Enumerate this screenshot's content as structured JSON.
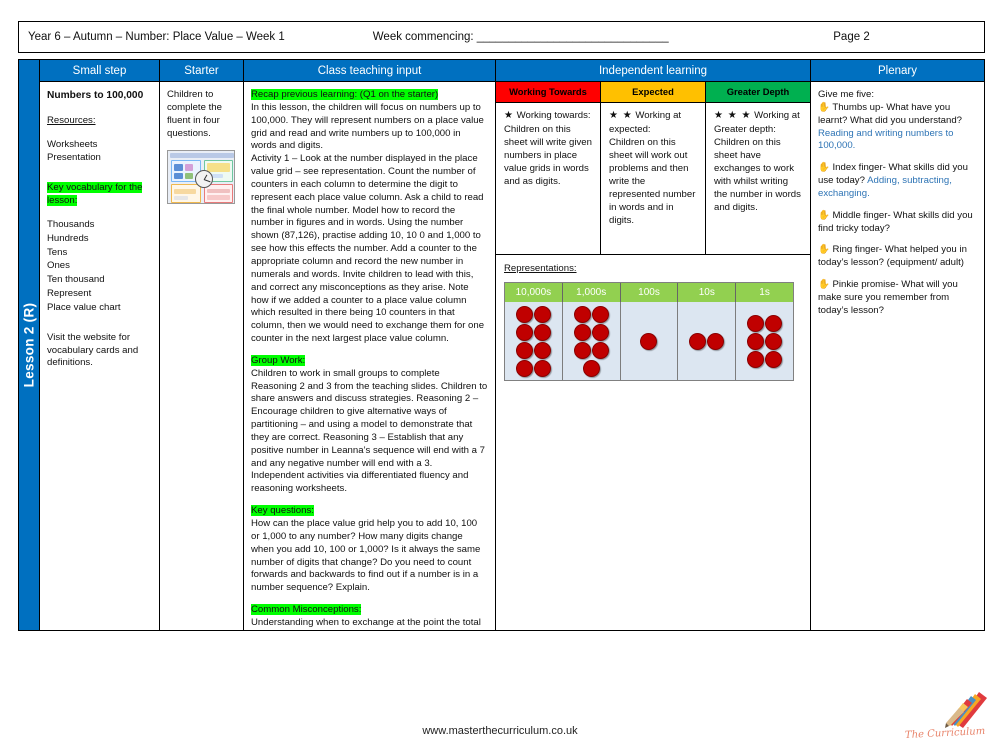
{
  "header": {
    "title": "Year 6 – Autumn – Number: Place Value – Week 1",
    "week_commencing_label": "Week commencing: ______________________________",
    "page_label": "Page 2"
  },
  "lesson_tab": {
    "label": "Lesson 2 (R)"
  },
  "columns": {
    "small_step": "Small step",
    "starter": "Starter",
    "class_teaching": "Class teaching input",
    "independent": "Independent learning",
    "plenary": "Plenary"
  },
  "small_step": {
    "title": "Numbers to 100,000",
    "resources_label": "Resources:",
    "resources": [
      "Worksheets",
      "Presentation"
    ],
    "vocab_heading": "Key vocabulary for the lesson:",
    "vocab": [
      "Thousands",
      "Hundreds",
      "Tens",
      "Ones",
      "Ten thousand",
      "Represent",
      "Place value chart"
    ],
    "footer_note": "Visit the website for vocabulary cards and definitions."
  },
  "starter": {
    "text": "Children to complete the fluent in four questions."
  },
  "class_teaching": {
    "blocks": [
      {
        "tag": "Recap previous learning: (Q1 on the starter)",
        "body": "In this lesson, the children will focus on numbers up to 100,000. They will represent numbers on a place value grid and read and write numbers up to 100,000 in words and digits.\nActivity 1 – Look at the number displayed in the place value grid – see representation. Count the number of counters in each column to determine the digit to represent each place value column. Ask a child to read the final whole number. Model how to record the number in figures and in words. Using the number shown (87,126), practise adding 10, 10 0 and 1,000 to see how this effects the number. Add a counter to the appropriate column and record the new number in numerals and words. Invite children to lead with this, and correct any misconceptions as they arise. Note how if we added a counter to a place value column which resulted in there being 10 counters in that column, then we would need to exchange them for one counter in the next largest place value column."
      },
      {
        "tag": "Group Work:",
        "body": "Children to work in small groups to complete Reasoning 2 and 3 from the teaching slides. Children to share answers and discuss strategies. Reasoning 2 – Encourage children to give alternative ways of partitioning – and using a model to demonstrate that they are correct. Reasoning 3 – Establish that any positive number in Leanna’s sequence will end with a 7 and any negative number will end with a 3. Independent activities via differentiated fluency and reasoning worksheets."
      },
      {
        "tag": "Key questions:",
        "body": "How can the place value grid help you to add 10, 100 or 1,000 to any number? How many digits change when you add 10, 100 or 1,000? Is it always the same number of digits that change? Do you need to count forwards and backwards to find out if a number is in a number sequence? Explain."
      },
      {
        "tag": "Common Misconceptions:",
        "body": "Understanding when to exchange at the point the total number of counters exceeds ten in a place value column as a result of adding or subtracting.\nForming a range of alternative partitioned number sentences using accurate mental addition and subtraction strategies."
      }
    ]
  },
  "independent": {
    "bands": [
      {
        "label": "Working Towards",
        "color": "#FF0000",
        "stars": "★",
        "text": "Working towards:\nChildren on this sheet will write given numbers in place value grids in words and as digits."
      },
      {
        "label": "Expected",
        "color": "#FFC000",
        "stars": "★ ★",
        "text": "Working at expected:\nChildren on this sheet will work out problems and then write the represented number in words and in digits."
      },
      {
        "label": "Greater Depth",
        "color": "#00B050",
        "stars": "★ ★ ★",
        "text": "Working at Greater depth:\nChildren on this sheet have exchanges to work with whilst writing the number in words and digits."
      }
    ],
    "representations_label": "Representations:",
    "place_value_chart": {
      "headers": [
        "10,000s",
        "1,000s",
        "100s",
        "10s",
        "1s"
      ],
      "counts": [
        8,
        7,
        1,
        2,
        6
      ],
      "number_represented": "87,126",
      "counter_color": "#C00000",
      "header_color": "#92D050"
    }
  },
  "plenary": {
    "intro": "Give me five:",
    "items": [
      {
        "icon": "hand-icon",
        "question": "Thumbs up- What have you learnt? What did you understand?",
        "answer": "Reading and writing numbers to 100,000."
      },
      {
        "icon": "hand-icon",
        "question": "Index finger- What skills did you use today?",
        "answer": "Adding, subtracting, exchanging."
      },
      {
        "icon": "hand-icon",
        "question": "Middle finger- What skills did you find tricky today?",
        "answer": ""
      },
      {
        "icon": "hand-icon",
        "question": "Ring finger- What helped you in today’s lesson? (equipment/ adult)",
        "answer": ""
      },
      {
        "icon": "hand-icon",
        "question": "Pinkie promise- What will you make sure you remember from today’s lesson?",
        "answer": ""
      }
    ]
  },
  "footer": {
    "url": "www.masterthecurriculum.co.uk",
    "logo_text": "The Curriculum"
  }
}
